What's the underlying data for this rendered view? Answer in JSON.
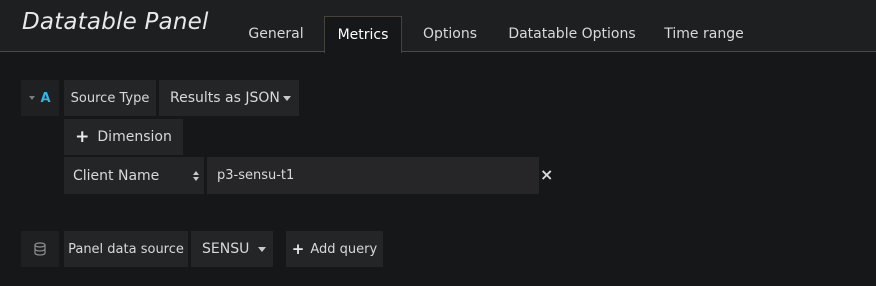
{
  "header": {
    "title": "Datatable Panel",
    "tabs": [
      {
        "label": "General"
      },
      {
        "label": "Metrics"
      },
      {
        "label": "Options"
      },
      {
        "label": "Datatable Options"
      },
      {
        "label": "Time range"
      }
    ],
    "active_tab": "Metrics"
  },
  "query": {
    "ref_id": "A",
    "source_type_label": "Source Type",
    "source_type_value": "Results as JSON",
    "add_dimension_label": "Dimension",
    "dimension_key": "Client Name",
    "dimension_value": "p3-sensu-t1",
    "remove_icon": "×"
  },
  "footer": {
    "panel_data_source_label": "Panel data source",
    "datasource_value": "SENSU",
    "add_query_label": "Add query"
  },
  "colors": {
    "background": "#161719",
    "accent_blue": "#33b5e5",
    "tab_border": "#4d4a3a"
  }
}
